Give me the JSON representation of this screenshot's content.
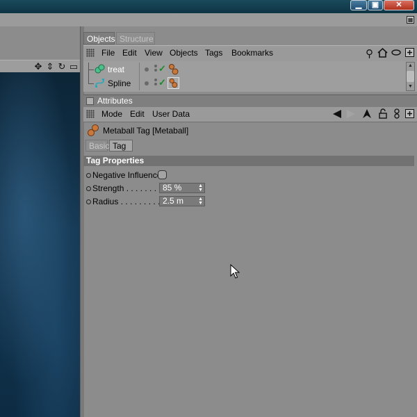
{
  "window": {
    "minimize_glyph": "▁",
    "maximize_glyph": "▣",
    "close_glyph": "✕"
  },
  "viewport": {
    "tools": [
      "move-icon",
      "scale-icon",
      "rotate-icon",
      "maximize-view-icon"
    ]
  },
  "object_manager": {
    "tabs": [
      {
        "label": "Objects",
        "active": true
      },
      {
        "label": "Structure",
        "active": false
      }
    ],
    "menu": [
      "File",
      "Edit",
      "View",
      "Objects",
      "Tags",
      "Bookmarks"
    ],
    "tools": [
      "search-icon",
      "home-icon",
      "eye-icon",
      "new-window-icon"
    ],
    "objects": [
      {
        "name": "treat",
        "icon": "metaball-object-icon",
        "selected_text": true
      },
      {
        "name": "Spline",
        "icon": "spline-object-icon",
        "tag_selected": true
      }
    ]
  },
  "attribute_manager": {
    "title": "Attributes",
    "menu": [
      "Mode",
      "Edit",
      "User Data"
    ],
    "tag_title": "Metaball Tag [Metaball]",
    "tabs": [
      {
        "label": "Basic",
        "active": false
      },
      {
        "label": "Tag",
        "active": true
      }
    ],
    "section": "Tag Properties",
    "properties": {
      "negative_influence": {
        "label": "Negative Influence",
        "checked": false
      },
      "strength": {
        "label": "Strength . . . . . . . .",
        "value": "85 %"
      },
      "radius": {
        "label": "Radius . . . . . . . . .",
        "value": "2.5 m"
      }
    }
  },
  "colors": {
    "panel_bg": "#8c8c8c",
    "header_bg": "#727272",
    "check_green": "#1c8a2a",
    "tag_orange": "#c8783a"
  }
}
